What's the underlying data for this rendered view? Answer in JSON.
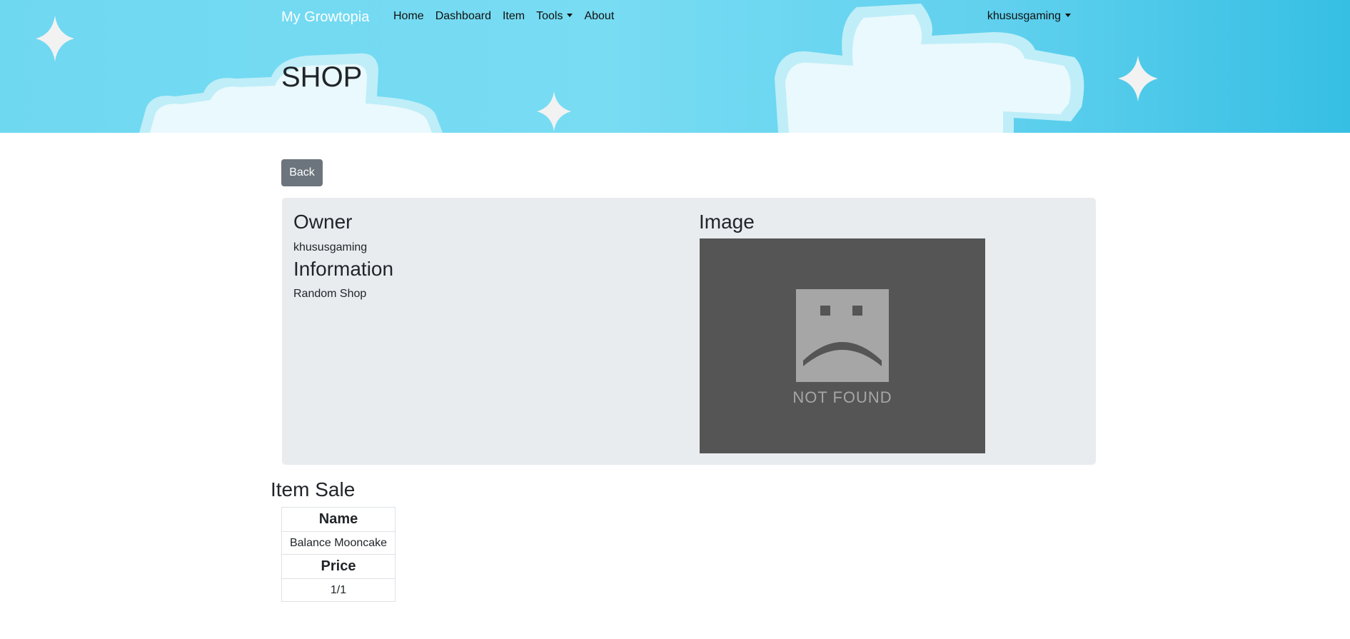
{
  "navbar": {
    "brand": "My Growtopia",
    "links": [
      "Home",
      "Dashboard",
      "Item",
      "Tools",
      "About"
    ],
    "user": "khususgaming"
  },
  "hero": {
    "title": "SHOP"
  },
  "actions": {
    "back_label": "Back"
  },
  "shop_card": {
    "owner_heading": "Owner",
    "owner_value": "khususgaming",
    "information_heading": "Information",
    "information_value": "Random Shop",
    "image_heading": "Image",
    "image_placeholder_text": "NOT FOUND",
    "image_placeholder_icon": "sad-face-icon"
  },
  "item_sale": {
    "title": "Item Sale",
    "name_header": "Name",
    "name_value": "Balance Mooncake",
    "price_header": "Price",
    "price_value": "1/1"
  },
  "colors": {
    "hero_sky": "#6fd8f1",
    "back_button": "#6c757d",
    "card_background": "#e9ecef",
    "image_placeholder": "#555555"
  }
}
